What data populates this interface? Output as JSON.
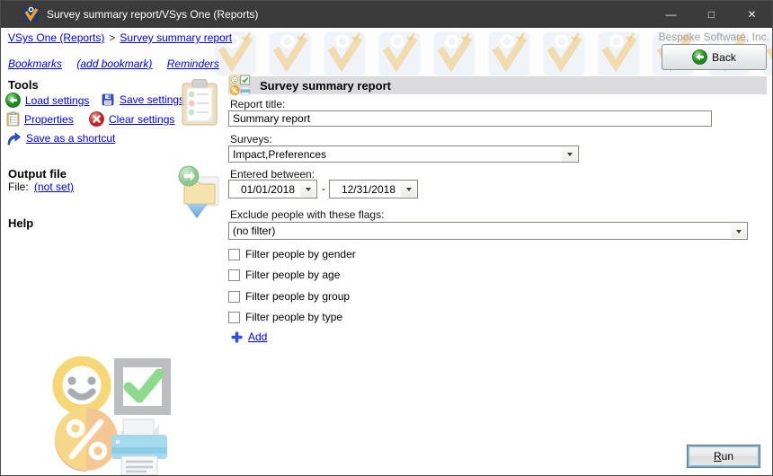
{
  "window": {
    "title": "Survey summary report/VSys One (Reports)",
    "controls": {
      "minimize": "—",
      "maximize": "□",
      "close": "✕"
    }
  },
  "header": {
    "breadcrumb": {
      "items": [
        {
          "label": "VSys One (Reports)"
        },
        {
          "label": "Survey summary report"
        }
      ],
      "separator": ">"
    },
    "quicklinks": [
      "Bookmarks",
      "(add bookmark)",
      "Reminders"
    ],
    "company": "Bespoke Software, Inc.",
    "back_label": "Back"
  },
  "sidebar": {
    "tools_title": "Tools",
    "tools": [
      {
        "label": "Load settings"
      },
      {
        "label": "Save settings"
      },
      {
        "label": "Properties"
      },
      {
        "label": "Clear settings"
      },
      {
        "label": "Save as a shortcut"
      }
    ],
    "output_title": "Output file",
    "file_label": "File:",
    "file_value": "(not set)",
    "help_title": "Help"
  },
  "form": {
    "title": "Survey summary report",
    "report_title_label": "Report title:",
    "report_title_value": "Summary report",
    "surveys_label": "Surveys:",
    "surveys_value": "Impact,Preferences",
    "entered_label": "Entered between:",
    "date_from": "01/01/2018",
    "date_to": "12/31/2018",
    "date_separator": "-",
    "exclude_label": "Exclude people with these flags:",
    "exclude_value": "(no filter)",
    "checkboxes": [
      {
        "label": "Filter people by gender",
        "checked": false
      },
      {
        "label": "Filter people by age",
        "checked": false
      },
      {
        "label": "Filter people by group",
        "checked": false
      },
      {
        "label": "Filter people by type",
        "checked": false
      }
    ],
    "add_label": "Add",
    "run_label": "Run"
  },
  "colors": {
    "titlebar": "#3b3b3b",
    "link": "#0000e6",
    "form_header_bar": "#dcdcde",
    "run_focus_ring": "#7eb4d8",
    "watermark_orange": "#f3bb4f"
  }
}
